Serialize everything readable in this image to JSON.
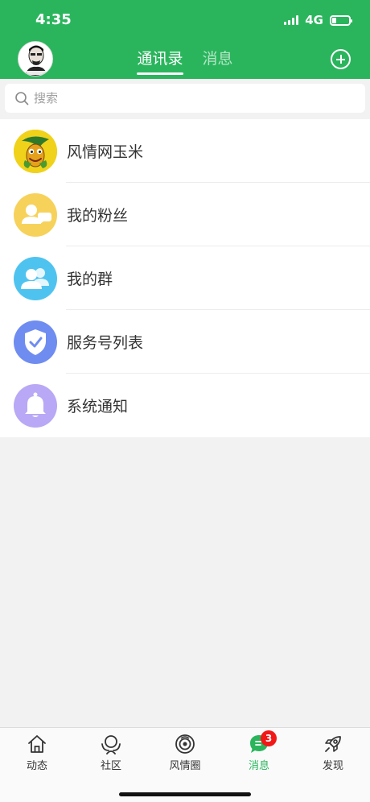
{
  "status_bar": {
    "time": "4:35",
    "network": "4G",
    "battery_level": 0.25
  },
  "header": {
    "tabs": [
      {
        "label": "通讯录",
        "active": true
      },
      {
        "label": "消息",
        "active": false
      }
    ]
  },
  "search": {
    "placeholder": "搜索"
  },
  "contacts": [
    {
      "label": "风情网玉米",
      "icon": "corn-mascot-avatar",
      "color": "#f0d21a"
    },
    {
      "label": "我的粉丝",
      "icon": "fans-icon",
      "color": "#f7d25a"
    },
    {
      "label": "我的群",
      "icon": "group-icon",
      "color": "#4fc3f0"
    },
    {
      "label": "服务号列表",
      "icon": "shield-check-icon",
      "color": "#6f8cf0"
    },
    {
      "label": "系统通知",
      "icon": "bell-icon",
      "color": "#b9a8f5"
    }
  ],
  "tabbar": {
    "items": [
      {
        "label": "动态",
        "icon": "house-icon"
      },
      {
        "label": "社区",
        "icon": "community-icon"
      },
      {
        "label": "风情圈",
        "icon": "circle-icon"
      },
      {
        "label": "消息",
        "icon": "chat-icon",
        "badge": "3",
        "active": true
      },
      {
        "label": "发现",
        "icon": "rocket-icon"
      }
    ]
  },
  "colors": {
    "brand": "#2ab55d",
    "badge": "#f21818"
  }
}
